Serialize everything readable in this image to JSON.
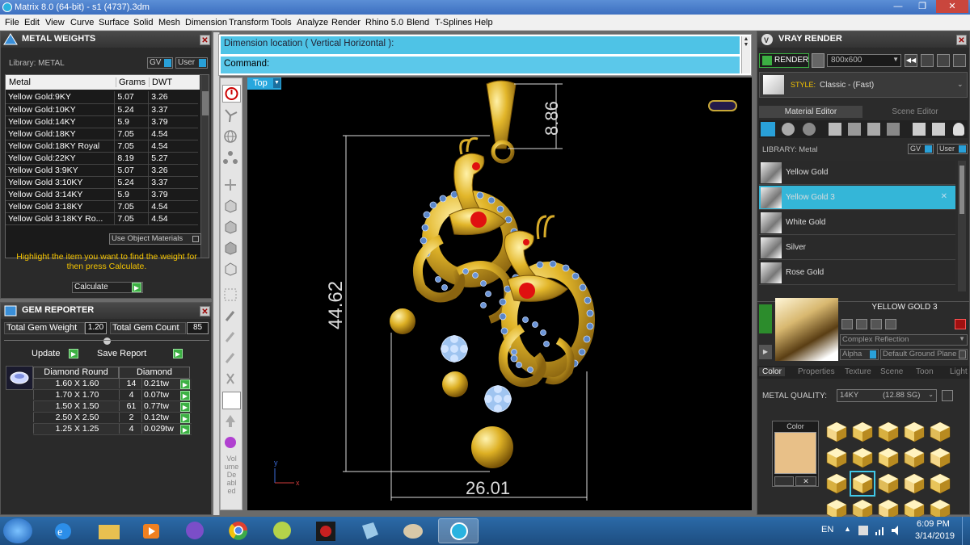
{
  "window": {
    "title": "Matrix 8.0 (64-bit) - s1 (4737).3dm"
  },
  "menu": [
    "File",
    "Edit",
    "View",
    "Curve",
    "Surface",
    "Solid",
    "Mesh",
    "Dimension",
    "Transform",
    "Tools",
    "Analyze",
    "Render",
    "Rhino 5.0",
    "Blend",
    "T-Splines",
    "Help"
  ],
  "metal_weights": {
    "title": "METAL WEIGHTS",
    "library_label": "Library: METAL",
    "gv": "GV",
    "user": "User",
    "columns": [
      "Metal",
      "Grams",
      "DWT"
    ],
    "rows": [
      [
        "Yellow Gold:9KY",
        "5.07",
        "3.26"
      ],
      [
        "Yellow Gold:10KY",
        "5.24",
        "3.37"
      ],
      [
        "Yellow Gold:14KY",
        "5.9",
        "3.79"
      ],
      [
        "Yellow Gold:18KY",
        "7.05",
        "4.54"
      ],
      [
        "Yellow Gold:18KY Royal",
        "7.05",
        "4.54"
      ],
      [
        "Yellow Gold:22KY",
        "8.19",
        "5.27"
      ],
      [
        "Yellow Gold 3:9KY",
        "5.07",
        "3.26"
      ],
      [
        "Yellow Gold 3:10KY",
        "5.24",
        "3.37"
      ],
      [
        "Yellow Gold 3:14KY",
        "5.9",
        "3.79"
      ],
      [
        "Yellow Gold 3:18KY",
        "7.05",
        "4.54"
      ],
      [
        "Yellow Gold 3:18KY Ro...",
        "7.05",
        "4.54"
      ]
    ],
    "use_object_materials": "Use Object Materials",
    "hint": "Highlight the item you want to find the weight for then press Calculate.",
    "calculate": "Calculate"
  },
  "gem_reporter": {
    "title": "GEM REPORTER",
    "total_gem_weight_label": "Total Gem Weight",
    "total_gem_weight": "1.20",
    "total_gem_count_label": "Total Gem Count",
    "total_gem_count": "85",
    "update": "Update",
    "save_report": "Save Report",
    "columns": [
      "Diamond Round",
      "Diamond"
    ],
    "rows": [
      [
        "1.60 X 1.60",
        "14",
        "0.21tw"
      ],
      [
        "1.70 X 1.70",
        "4",
        "0.07tw"
      ],
      [
        "1.50 X 1.50",
        "61",
        "0.77tw"
      ],
      [
        "2.50 X 2.50",
        "2",
        "0.12tw"
      ],
      [
        "1.25 X 1.25",
        "4",
        "0.029tw"
      ]
    ]
  },
  "command": {
    "line1": "Dimension location ( Vertical  Horizontal ):",
    "line2": "Command:"
  },
  "viewport": {
    "view": "Top",
    "dims": [
      "8.86",
      "44.62",
      "26.01"
    ],
    "axis_y": "y",
    "axis_x": "x"
  },
  "side_toolbar": {
    "label": "Vol ume De abl ed"
  },
  "vray": {
    "title": "VRAY RENDER",
    "render": "RENDER",
    "resolution": "800x600",
    "style_label": "STYLE:",
    "style_value": "Classic - (Fast)",
    "tabs": [
      "Material Editor",
      "Scene Editor"
    ],
    "library_label": "LIBRARY: Metal",
    "gv": "GV",
    "user": "User",
    "materials": [
      "Yellow Gold",
      "Yellow Gold 3",
      "White Gold",
      "Silver",
      "Rose Gold"
    ],
    "selected_material": "YELLOW GOLD 3",
    "reflection": "Complex Reflection",
    "alpha": "Alpha",
    "ground": "Default Ground Plane",
    "subtabs": [
      "Color",
      "Properties",
      "Texture",
      "Scene",
      "Toon",
      "Light"
    ],
    "metal_quality_label": "METAL QUALITY:",
    "metal_quality": "14KY",
    "metal_quality_sg": "(12.88 SG)",
    "color_label": "Color",
    "swatch_color": "#e8c088"
  },
  "taskbar": {
    "lang": "EN",
    "time": "6:09 PM",
    "date": "3/14/2019"
  }
}
